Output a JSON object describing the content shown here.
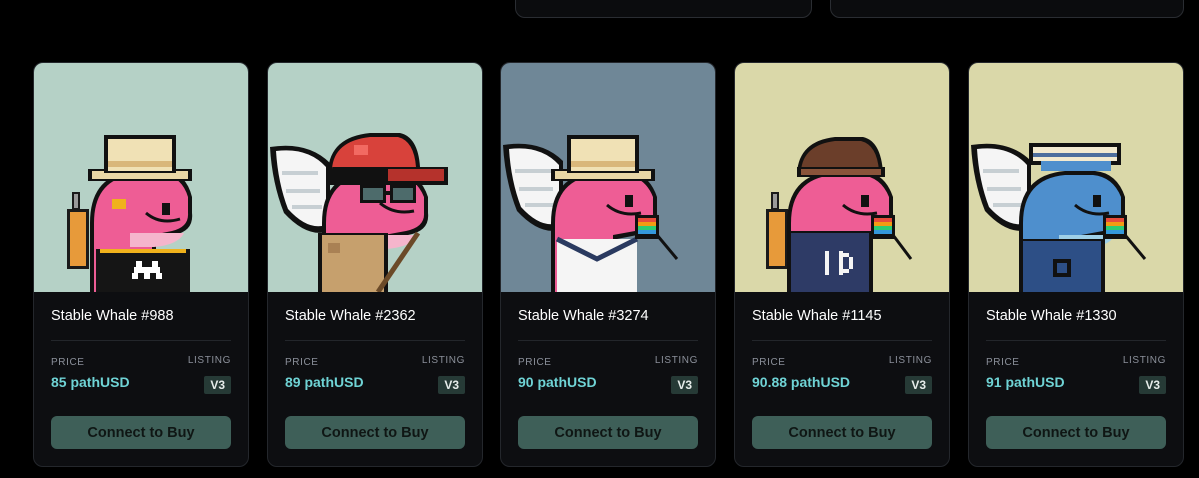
{
  "cards": [
    {
      "name": "Stable Whale #988",
      "price_label": "PRICE",
      "price": "85 pathUSD",
      "listing_label": "LISTING",
      "listing": "V3",
      "button": "Connect to Buy",
      "bg": "#b5d1c6",
      "body": "#ee5d95",
      "hat": "straw-hat",
      "outfit": "black-tee-invader",
      "accessory": "jetpack"
    },
    {
      "name": "Stable Whale #2362",
      "price_label": "PRICE",
      "price": "89 pathUSD",
      "listing_label": "LISTING",
      "listing": "V3",
      "button": "Connect to Buy",
      "bg": "#b5d1c6",
      "body": "#ee5d95",
      "hat": "red-cap",
      "outfit": "tan-jacket",
      "accessory": "wings-glasses"
    },
    {
      "name": "Stable Whale #3274",
      "price_label": "PRICE",
      "price": "90 pathUSD",
      "listing_label": "LISTING",
      "listing": "V3",
      "button": "Connect to Buy",
      "bg": "#6f8797",
      "body": "#ee5d95",
      "hat": "straw-hat",
      "outfit": "sailor-top",
      "accessory": "wings-rainbow"
    },
    {
      "name": "Stable Whale #1145",
      "price_label": "PRICE",
      "price": "90.88 pathUSD",
      "listing_label": "LISTING",
      "listing": "V3",
      "button": "Connect to Buy",
      "bg": "#dad8a9",
      "body": "#ee5d95",
      "hat": "brown-cap",
      "outfit": "navy-hoodie",
      "accessory": "jetpack-rainbow"
    },
    {
      "name": "Stable Whale #1330",
      "price_label": "PRICE",
      "price": "91 pathUSD",
      "listing_label": "LISTING",
      "listing": "V3",
      "button": "Connect to Buy",
      "bg": "#dad8a9",
      "body": "#4e8fcd",
      "hat": "headband",
      "outfit": "navy-jacket",
      "accessory": "wings-rainbow"
    }
  ]
}
